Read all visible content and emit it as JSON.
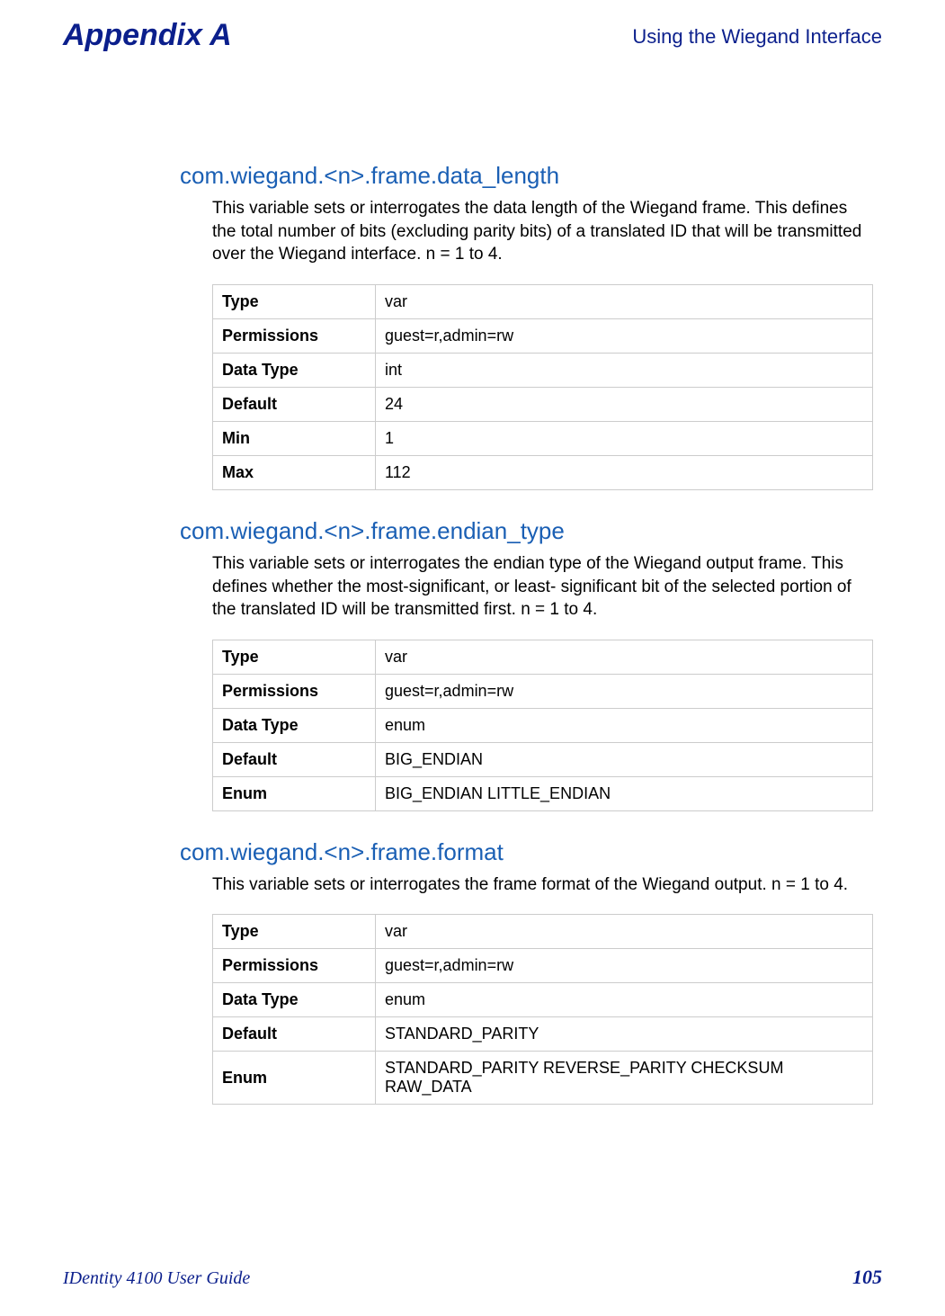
{
  "header": {
    "left": "Appendix A",
    "right": "Using the Wiegand Interface"
  },
  "sections": [
    {
      "title": "com.wiegand.<n>.frame.data_length",
      "desc": "This variable sets or interrogates the data length of the Wiegand frame. This defines the total number of bits (excluding parity bits) of a translated ID that will be transmitted over the Wiegand interface. n = 1 to 4.",
      "rows": [
        {
          "label": "Type",
          "value": "var"
        },
        {
          "label": "Permissions",
          "value": "guest=r,admin=rw"
        },
        {
          "label": "Data Type",
          "value": "int"
        },
        {
          "label": "Default",
          "value": "24"
        },
        {
          "label": "Min",
          "value": "1"
        },
        {
          "label": "Max",
          "value": "112"
        }
      ]
    },
    {
      "title": "com.wiegand.<n>.frame.endian_type",
      "desc": "This variable sets or interrogates the endian type of the Wiegand output frame. This defines whether the most-significant, or least- significant bit of the selected portion of the translated ID will be transmitted first. n = 1 to 4.",
      "rows": [
        {
          "label": "Type",
          "value": "var"
        },
        {
          "label": "Permissions",
          "value": "guest=r,admin=rw"
        },
        {
          "label": "Data Type",
          "value": "enum"
        },
        {
          "label": "Default",
          "value": "BIG_ENDIAN"
        },
        {
          "label": "Enum",
          "value": "BIG_ENDIAN LITTLE_ENDIAN"
        }
      ]
    },
    {
      "title": "com.wiegand.<n>.frame.format",
      "desc": "This variable sets or interrogates the frame format of the Wiegand output. n = 1 to 4.",
      "rows": [
        {
          "label": "Type",
          "value": "var"
        },
        {
          "label": "Permissions",
          "value": "guest=r,admin=rw"
        },
        {
          "label": "Data Type",
          "value": "enum"
        },
        {
          "label": "Default",
          "value": "STANDARD_PARITY"
        },
        {
          "label": "Enum",
          "value": "STANDARD_PARITY REVERSE_PARITY CHECKSUM RAW_DATA"
        }
      ]
    }
  ],
  "footer": {
    "left": "IDentity 4100 User Guide",
    "right": "105"
  }
}
